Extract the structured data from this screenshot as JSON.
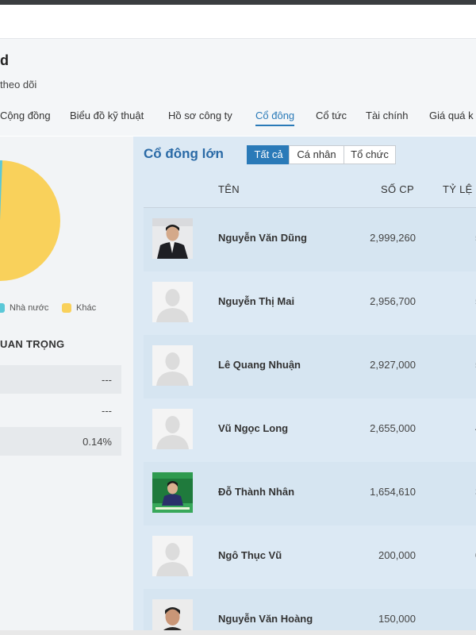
{
  "header": {
    "title": "d",
    "follow_text": "theo dõi"
  },
  "tabs": [
    {
      "label": "Cộng đồng",
      "active": false
    },
    {
      "label": "Biểu đồ kỹ thuật",
      "active": false
    },
    {
      "label": "Hồ sơ công ty",
      "active": false
    },
    {
      "label": "Cổ đông",
      "active": true
    },
    {
      "label": "Cổ tức",
      "active": false
    },
    {
      "label": "Tài chính",
      "active": false
    },
    {
      "label": "Giá quá k",
      "active": false
    }
  ],
  "left_panel": {
    "legend": [
      {
        "label": "Nhà nước",
        "color": "#5bc8d8"
      },
      {
        "label": "Khác",
        "color": "#f9d15b"
      }
    ],
    "section_title": "UAN TRỌNG",
    "metrics": [
      {
        "value": "---"
      },
      {
        "value": "---"
      },
      {
        "value": "0.14%"
      }
    ]
  },
  "shareholders": {
    "title": "Cổ đông lớn",
    "filters": [
      {
        "label": "Tất cả",
        "active": true
      },
      {
        "label": "Cá nhân",
        "active": false
      },
      {
        "label": "Tổ chức",
        "active": false
      }
    ],
    "columns": {
      "name": "TÊN",
      "shares": "SỐ CP",
      "ratio": "TỶ LỆ"
    },
    "rows": [
      {
        "name": "Nguyễn Văn Dũng",
        "shares": "2,999,260",
        "avatar": "photo-suit"
      },
      {
        "name": "Nguyễn Thị Mai",
        "shares": "2,956,700",
        "avatar": "placeholder"
      },
      {
        "name": "Lê Quang Nhuận",
        "shares": "2,927,000",
        "avatar": "placeholder"
      },
      {
        "name": "Vũ Ngọc Long",
        "shares": "2,655,000",
        "avatar": "placeholder"
      },
      {
        "name": "Đỗ Thành Nhân",
        "shares": "1,654,610",
        "avatar": "photo-green"
      },
      {
        "name": "Ngô Thục Vũ",
        "shares": "200,000",
        "avatar": "placeholder"
      },
      {
        "name": "Nguyễn Văn Hoàng",
        "shares": "150,000",
        "avatar": "photo-portrait"
      }
    ]
  },
  "colors": {
    "accent": "#2a7ab8",
    "pie_main": "#f9d15b",
    "pie_sliver": "#5bc8d8",
    "panel_bg": "#dce9f4"
  }
}
